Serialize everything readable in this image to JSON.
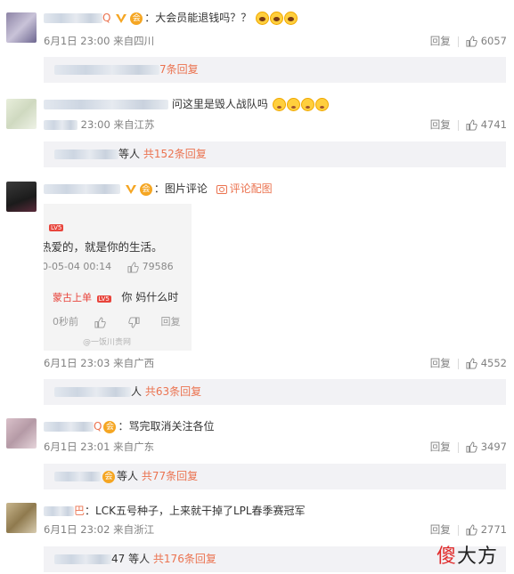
{
  "comments": [
    {
      "user_suffix": "Q",
      "text": "：大会员能退钱吗？？",
      "time": "6月1日 23:00",
      "source": "来自四川",
      "reply_label": "回复",
      "likes": "6057",
      "reply_count_text": "7条回复"
    },
    {
      "user_suffix": "",
      "text": "问这里是毁人战队吗",
      "time": "23:00",
      "source": "来自江苏",
      "reply_label": "回复",
      "likes": "4741",
      "reply_prefix": "等人",
      "reply_count_text": "共152条回复"
    },
    {
      "user_suffix": "",
      "text": "：图片评论",
      "view_pic": "评论配图",
      "time": "6月1日 23:03",
      "source": "来自广西",
      "reply_label": "回复",
      "likes": "4552",
      "reply_prefix": "人",
      "reply_count_text": "共63条回复",
      "picture": {
        "tag": "LV5",
        "line1": "热爱的，就是你的生活。",
        "date": "0-05-04 00:14",
        "likes": "79586",
        "reply_user": "蒙古上单",
        "reply_tag": "LV5",
        "reply_text": "你 妈什么时",
        "ago": "0秒前",
        "reply": "回复",
        "mark": "@一饭川贵网"
      }
    },
    {
      "user_suffix": "Q",
      "text": "：骂完取消关注各位",
      "time": "6月1日 23:01",
      "source": "来自广东",
      "reply_label": "回复",
      "likes": "3497",
      "reply_prefix": "等人",
      "reply_count_text": "共77条回复"
    },
    {
      "user_suffix": "巴",
      "text": "：LCK五号种子，上来就干掉了LPL春季赛冠军",
      "time": "6月1日 23:02",
      "source": "来自浙江",
      "reply_label": "回复",
      "likes": "2771",
      "reply_prefix": "47 等人",
      "reply_count_text": "共176条回复"
    }
  ],
  "watermark": {
    "char1": "傻",
    "rest": "大方"
  },
  "colors": {
    "accent": "#eb7350",
    "meta": "#808080",
    "reply_bg": "#f2f2f5"
  }
}
